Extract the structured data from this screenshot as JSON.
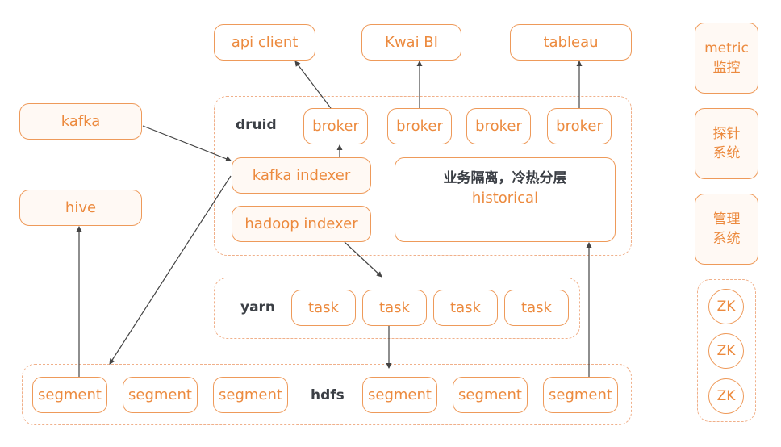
{
  "consumers": [
    {
      "label": "api client"
    },
    {
      "label": "Kwai BI"
    },
    {
      "label": "tableau"
    }
  ],
  "sources": {
    "kafka": "kafka",
    "hive": "hive"
  },
  "druid": {
    "label": "druid",
    "brokers": [
      "broker",
      "broker",
      "broker",
      "broker"
    ],
    "kafka_indexer": "kafka indexer",
    "hadoop_indexer": "hadoop indexer",
    "historical": {
      "title": "业务隔离，冷热分层",
      "label": "historical"
    }
  },
  "yarn": {
    "label": "yarn",
    "tasks": [
      "task",
      "task",
      "task",
      "task"
    ]
  },
  "hdfs": {
    "label": "hdfs",
    "segments": [
      "segment",
      "segment",
      "segment",
      "segment",
      "segment",
      "segment"
    ]
  },
  "side_systems": [
    {
      "line1": "metric",
      "line2": "监控"
    },
    {
      "line1": "探针",
      "line2": "系统"
    },
    {
      "line1": "管理",
      "line2": "系统"
    }
  ],
  "zookeeper": [
    "ZK",
    "ZK",
    "ZK"
  ],
  "colors": {
    "accent": "#ec8a3e",
    "border": "#ee9a5a",
    "dashed": "#f0b08a",
    "label_dark": "#3b3f45",
    "arrow": "#444444"
  }
}
